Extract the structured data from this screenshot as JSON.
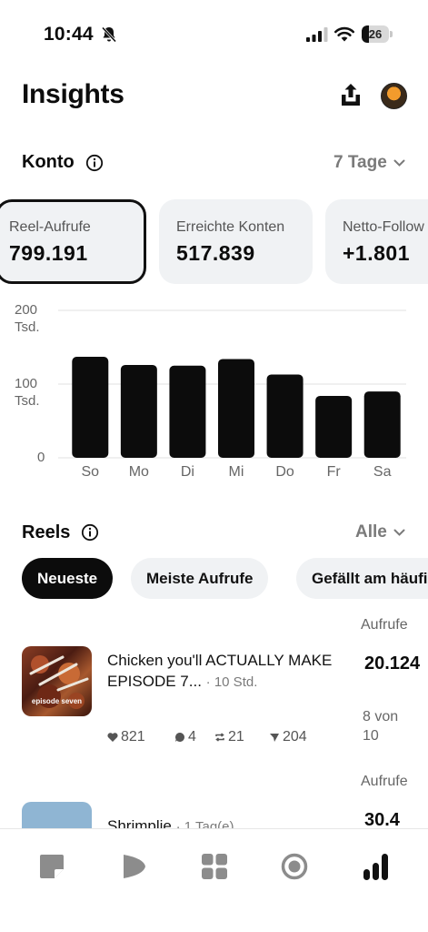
{
  "status_bar": {
    "time": "10:44",
    "battery": "26",
    "battery_level": 0.26
  },
  "header": {
    "title": "Insights"
  },
  "account": {
    "title": "Konto",
    "range": "7 Tage",
    "metrics": [
      {
        "label": "Reel-Aufrufe",
        "value": "799.191"
      },
      {
        "label": "Erreichte Konten",
        "value": "517.839"
      },
      {
        "label": "Netto-Follow",
        "value": "+1.801"
      }
    ]
  },
  "chart_data": {
    "type": "bar",
    "categories": [
      "So",
      "Mo",
      "Di",
      "Mi",
      "Do",
      "Fr",
      "Sa"
    ],
    "values": [
      137,
      126,
      125,
      134,
      113,
      84,
      90
    ],
    "yticks": [
      {
        "value": 200,
        "label_lines": [
          "200",
          "Tsd."
        ]
      },
      {
        "value": 100,
        "label_lines": [
          "100",
          "Tsd."
        ]
      },
      {
        "value": 0,
        "label_lines": [
          "0"
        ]
      }
    ],
    "ylim": [
      0,
      200
    ],
    "grid": true,
    "bar_color": "#0c0c0c"
  },
  "reels": {
    "title": "Reels",
    "filter": "Alle",
    "chips": [
      "Neueste",
      "Meiste Aufrufe",
      "Gefällt am häufigsten"
    ],
    "items": [
      {
        "title": "Chicken you'll ACTUALLY MAKE EPISODE 7...",
        "time": "· 10 Std.",
        "thumb_caption": "episode seven",
        "likes": "821",
        "comments": "4",
        "reposts": "21",
        "shares": "204",
        "side_label": "Aufrufe",
        "side_value": "20.124",
        "side_rank": "8 von 10"
      },
      {
        "title": "Shrimplie",
        "time": "· 1 Tag(e)",
        "side_label": "Aufrufe",
        "side_value": "30.4"
      }
    ]
  },
  "colors": {
    "accent": "#0c0c0c",
    "card_bg": "#f0f2f4",
    "muted": "#7a7a7a"
  },
  "nav": [
    "home-icon",
    "reels-icon",
    "grid-icon",
    "record-icon",
    "insights-icon"
  ]
}
